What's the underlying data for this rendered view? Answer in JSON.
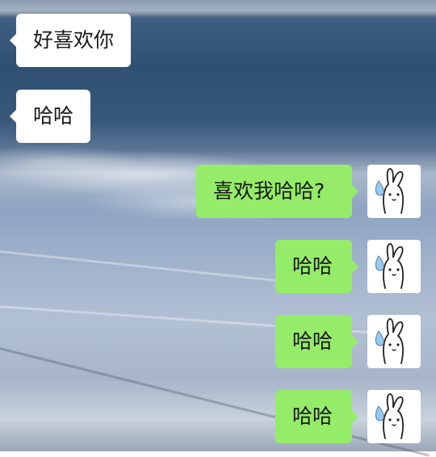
{
  "chat": {
    "messages": [
      {
        "side": "left",
        "text": "好喜欢你"
      },
      {
        "side": "left",
        "text": "哈哈"
      },
      {
        "side": "right",
        "text": "喜欢我哈哈?"
      },
      {
        "side": "right",
        "text": "哈哈"
      },
      {
        "side": "right",
        "text": "哈哈"
      },
      {
        "side": "right",
        "text": "哈哈"
      }
    ],
    "avatar_icon": "bunny-sweat-avatar-icon"
  },
  "colors": {
    "incoming_bubble": "#ffffff",
    "outgoing_bubble": "#95ec69",
    "text": "#191919"
  }
}
